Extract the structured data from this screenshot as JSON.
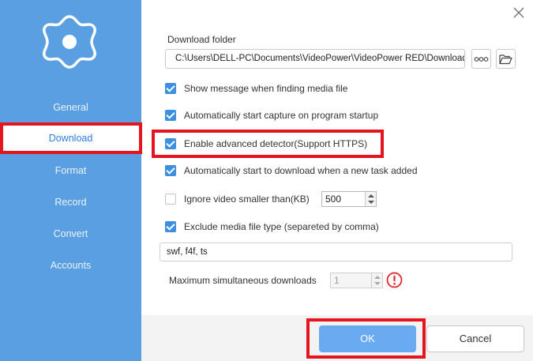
{
  "sidebar": {
    "items": [
      {
        "label": "General",
        "active": false
      },
      {
        "label": "Download",
        "active": true
      },
      {
        "label": "Format",
        "active": false
      },
      {
        "label": "Record",
        "active": false
      },
      {
        "label": "Convert",
        "active": false
      },
      {
        "label": "Accounts",
        "active": false
      }
    ]
  },
  "download_folder": {
    "label": "Download folder",
    "path": "C:\\Users\\DELL-PC\\Documents\\VideoPower\\VideoPower RED\\Downloads",
    "more_icon": "ellipsis-icon",
    "browse_icon": "folder-open-icon"
  },
  "options": {
    "show_message": {
      "label": "Show message when finding media file",
      "checked": true
    },
    "auto_capture": {
      "label": "Automatically start capture on program startup",
      "checked": true
    },
    "advanced_detector": {
      "label": "Enable advanced detector(Support HTTPS)",
      "checked": true
    },
    "auto_download": {
      "label": "Automatically start to download when a new task added",
      "checked": true
    },
    "ignore_small": {
      "label": "Ignore video smaller than(KB)",
      "checked": false,
      "value": "500"
    },
    "exclude_types": {
      "label": "Exclude media file type (separeted by comma)",
      "checked": true,
      "value": "swf, f4f, ts"
    },
    "max_downloads": {
      "label": "Maximum simultaneous downloads",
      "value": "1"
    }
  },
  "buttons": {
    "ok": "OK",
    "cancel": "Cancel"
  },
  "colors": {
    "sidebar": "#5b9fe3",
    "accent": "#3d8fe0",
    "ok_button": "#69aaf0",
    "highlight": "#e4151f",
    "warning": "#e0262b"
  }
}
